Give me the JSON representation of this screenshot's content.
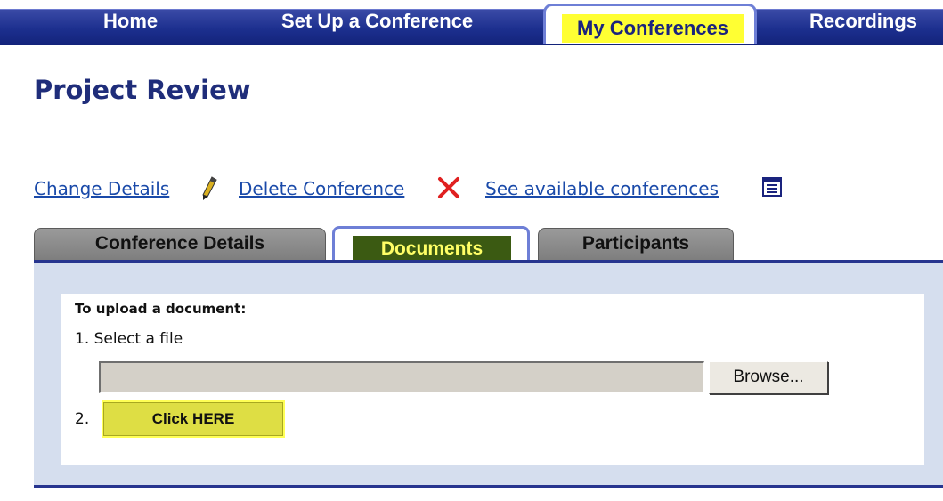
{
  "nav": {
    "items": [
      {
        "label": "Home"
      },
      {
        "label": "Set Up a Conference"
      },
      {
        "label": "My Conferences",
        "active": true
      },
      {
        "label": "Recordings"
      }
    ],
    "active_highlight_color": "#ffff33"
  },
  "page": {
    "title": "Project Review"
  },
  "actions": {
    "change_details": {
      "label": "Change Details",
      "icon": "pencil-icon"
    },
    "delete_conference": {
      "label": "Delete Conference",
      "icon": "x-icon"
    },
    "see_available": {
      "label": "See available conferences",
      "icon": "list-icon"
    }
  },
  "tabs": [
    {
      "label": "Conference Details"
    },
    {
      "label": "Documents",
      "active": true
    },
    {
      "label": "Participants"
    }
  ],
  "upload": {
    "heading": "To upload a document:",
    "step1": "1. Select a file",
    "file_value": "",
    "browse_label": "Browse...",
    "step2": "2.",
    "click_label": "Click HERE"
  },
  "colors": {
    "nav_bg": "#1c2f8e",
    "title": "#1f2d7a",
    "link": "#1a4aa9",
    "panel_bg": "#d5deee",
    "active_tab_bg": "#3b5a12",
    "active_tab_text": "#ffff66",
    "delete_icon": "#e02020"
  }
}
